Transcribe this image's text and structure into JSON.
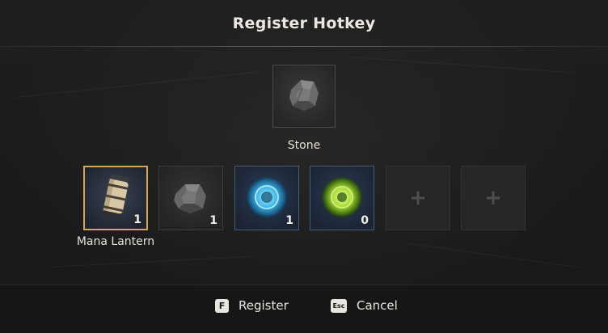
{
  "dialog": {
    "title": "Register Hotkey"
  },
  "preview": {
    "item_name": "Stone",
    "icon": "stone-icon"
  },
  "slots": [
    {
      "icon": "mana-lantern-icon",
      "count": "1",
      "selected": true,
      "label": "Mana Lantern"
    },
    {
      "icon": "stone-icon",
      "count": "1",
      "selected": false
    },
    {
      "icon": "blue-orb-icon",
      "count": "1",
      "selected": false
    },
    {
      "icon": "green-orb-icon",
      "count": "0",
      "selected": false
    },
    {
      "icon": "plus-icon",
      "count": "",
      "empty": true,
      "glyph": "+"
    },
    {
      "icon": "plus-icon",
      "count": "",
      "empty": true,
      "glyph": "+"
    }
  ],
  "footer": {
    "register": {
      "key": "F",
      "label": "Register"
    },
    "cancel": {
      "key": "Esc",
      "label": "Cancel"
    }
  },
  "colors": {
    "selected_border": "#d9a35a",
    "background": "#1c1c1c",
    "key_cap": "#e9e6df"
  }
}
